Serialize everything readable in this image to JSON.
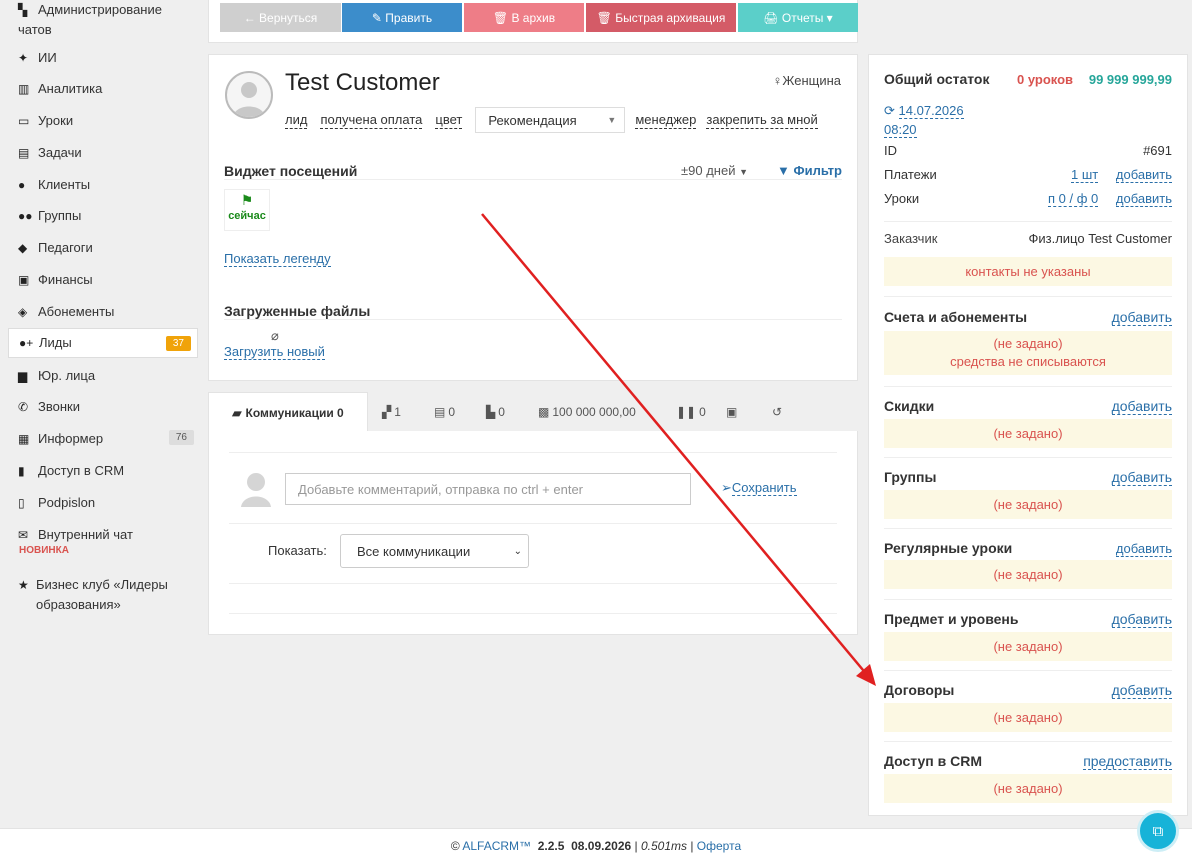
{
  "sidebar": {
    "items": [
      {
        "label": "Администрирование чатов"
      },
      {
        "label": "ИИ"
      },
      {
        "label": "Аналитика"
      },
      {
        "label": "Уроки"
      },
      {
        "label": "Задачи"
      },
      {
        "label": "Клиенты"
      },
      {
        "label": "Группы"
      },
      {
        "label": "Педагоги"
      },
      {
        "label": "Финансы"
      },
      {
        "label": "Абонементы"
      },
      {
        "label": "Лиды",
        "badge": "37"
      },
      {
        "label": "Юр. лица"
      },
      {
        "label": "Звонки"
      },
      {
        "label": "Информер",
        "badge": "76"
      },
      {
        "label": "Доступ в CRM"
      },
      {
        "label": "Podpislon"
      },
      {
        "label": "Внутренний чат",
        "tag": "НОВИНКА"
      },
      {
        "label": "Бизнес клуб «Лидеры образования»"
      }
    ]
  },
  "toolbar": {
    "back": "← Вернуться",
    "edit": "✎ Править",
    "archive": "🗑 В архив",
    "quick_archive": "🗑 Быстрая архивация",
    "reports": "🖨 Отчеты ▾",
    "colors": {
      "back": "#cfcfcf",
      "edit": "#3c8dcb",
      "archive": "#ee7d87",
      "quick_archive": "#d45b67",
      "reports": "#5bcfc9"
    }
  },
  "customer": {
    "name": "Test Customer",
    "gender": "Женщина",
    "links": [
      "лид",
      "получена оплата",
      "цвет"
    ],
    "source_select": "Рекомендация",
    "manager": "менеджер",
    "pin": "закрепить за мной"
  },
  "visits": {
    "title": "Виджет посещений",
    "range": "±90 дней",
    "filter": "Фильтр",
    "now": "сейчас",
    "legend": "Показать легенду"
  },
  "files": {
    "title": "Загруженные файлы",
    "upload": "Загрузить новый"
  },
  "tabs": {
    "comm": "Коммуникации 0",
    "t1": "1",
    "t2": "0",
    "t3": "0",
    "t4": "100 000 000,00",
    "t5": "0"
  },
  "comment": {
    "placeholder": "Добавьте комментарий, отправка по ctrl + enter",
    "save": "Сохранить",
    "show_label": "Показать:",
    "show_value": "Все коммуникации"
  },
  "right": {
    "balance_title": "Общий остаток",
    "balance_lessons": "0 уроков",
    "balance_money": "99 999 999,99",
    "date": "14.07.2026",
    "time": "08:20",
    "id_label": "ID",
    "id_value": "#691",
    "payments_label": "Платежи",
    "payments_value": "1 шт",
    "lessons_label": "Уроки",
    "lessons_value": "п 0 / ф 0",
    "add": "добавить",
    "customer_label": "Заказчик",
    "customer_value": "Физ.лицо Test Customer",
    "no_contacts": "контакты не указаны",
    "not_set": "(не задано)",
    "no_charge": "средства не списываются",
    "grant": "предоставить",
    "sections": [
      "Счета и абонементы",
      "Скидки",
      "Группы",
      "Регулярные уроки",
      "Предмет и уровень",
      "Договоры",
      "Доступ в CRM"
    ]
  },
  "footer": {
    "brand": "ALFACRM™",
    "version": "2.2.5",
    "date": "08.09.2026",
    "time": "0.501ms",
    "offer": "Оферта"
  }
}
